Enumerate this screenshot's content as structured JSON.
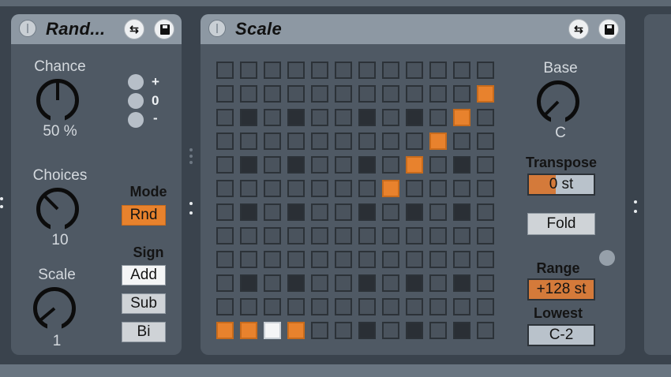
{
  "random_device": {
    "title": "Rand...",
    "chance": {
      "label": "Chance",
      "value": "50 %"
    },
    "choices": {
      "label": "Choices",
      "value": "10"
    },
    "scale": {
      "label": "Scale",
      "value": "1"
    },
    "legend": {
      "plus": "+",
      "zero": "0",
      "minus": "-"
    },
    "mode": {
      "label": "Mode",
      "button": "Rnd"
    },
    "sign": {
      "label": "Sign",
      "options": [
        "Add",
        "Sub",
        "Bi"
      ],
      "selected": "Add"
    }
  },
  "scale_device": {
    "title": "Scale",
    "base": {
      "label": "Base",
      "value": "C"
    },
    "transpose": {
      "label": "Transpose",
      "value": "0 st"
    },
    "fold_button": "Fold",
    "range": {
      "label": "Range",
      "value": "+128 st"
    },
    "lowest": {
      "label": "Lowest",
      "value": "C-2"
    },
    "grid": {
      "rows": 12,
      "cols": 12,
      "black_key_rows": [
        2,
        4,
        6,
        9,
        11
      ],
      "black_key_cols": [
        1,
        3,
        6,
        8,
        10
      ],
      "active_cells": [
        [
          1,
          11
        ],
        [
          2,
          10
        ],
        [
          3,
          9
        ],
        [
          4,
          8
        ],
        [
          5,
          7
        ]
      ],
      "bottom_row": [
        "orange",
        "orange",
        "white",
        "orange"
      ]
    }
  },
  "header_icons": [
    "power-icon",
    "hot-swap-icon",
    "save-icon"
  ],
  "colors": {
    "accent": "#e8822d",
    "panel": "#4f5964",
    "header": "#8d98a3",
    "background": "#3a434d"
  }
}
